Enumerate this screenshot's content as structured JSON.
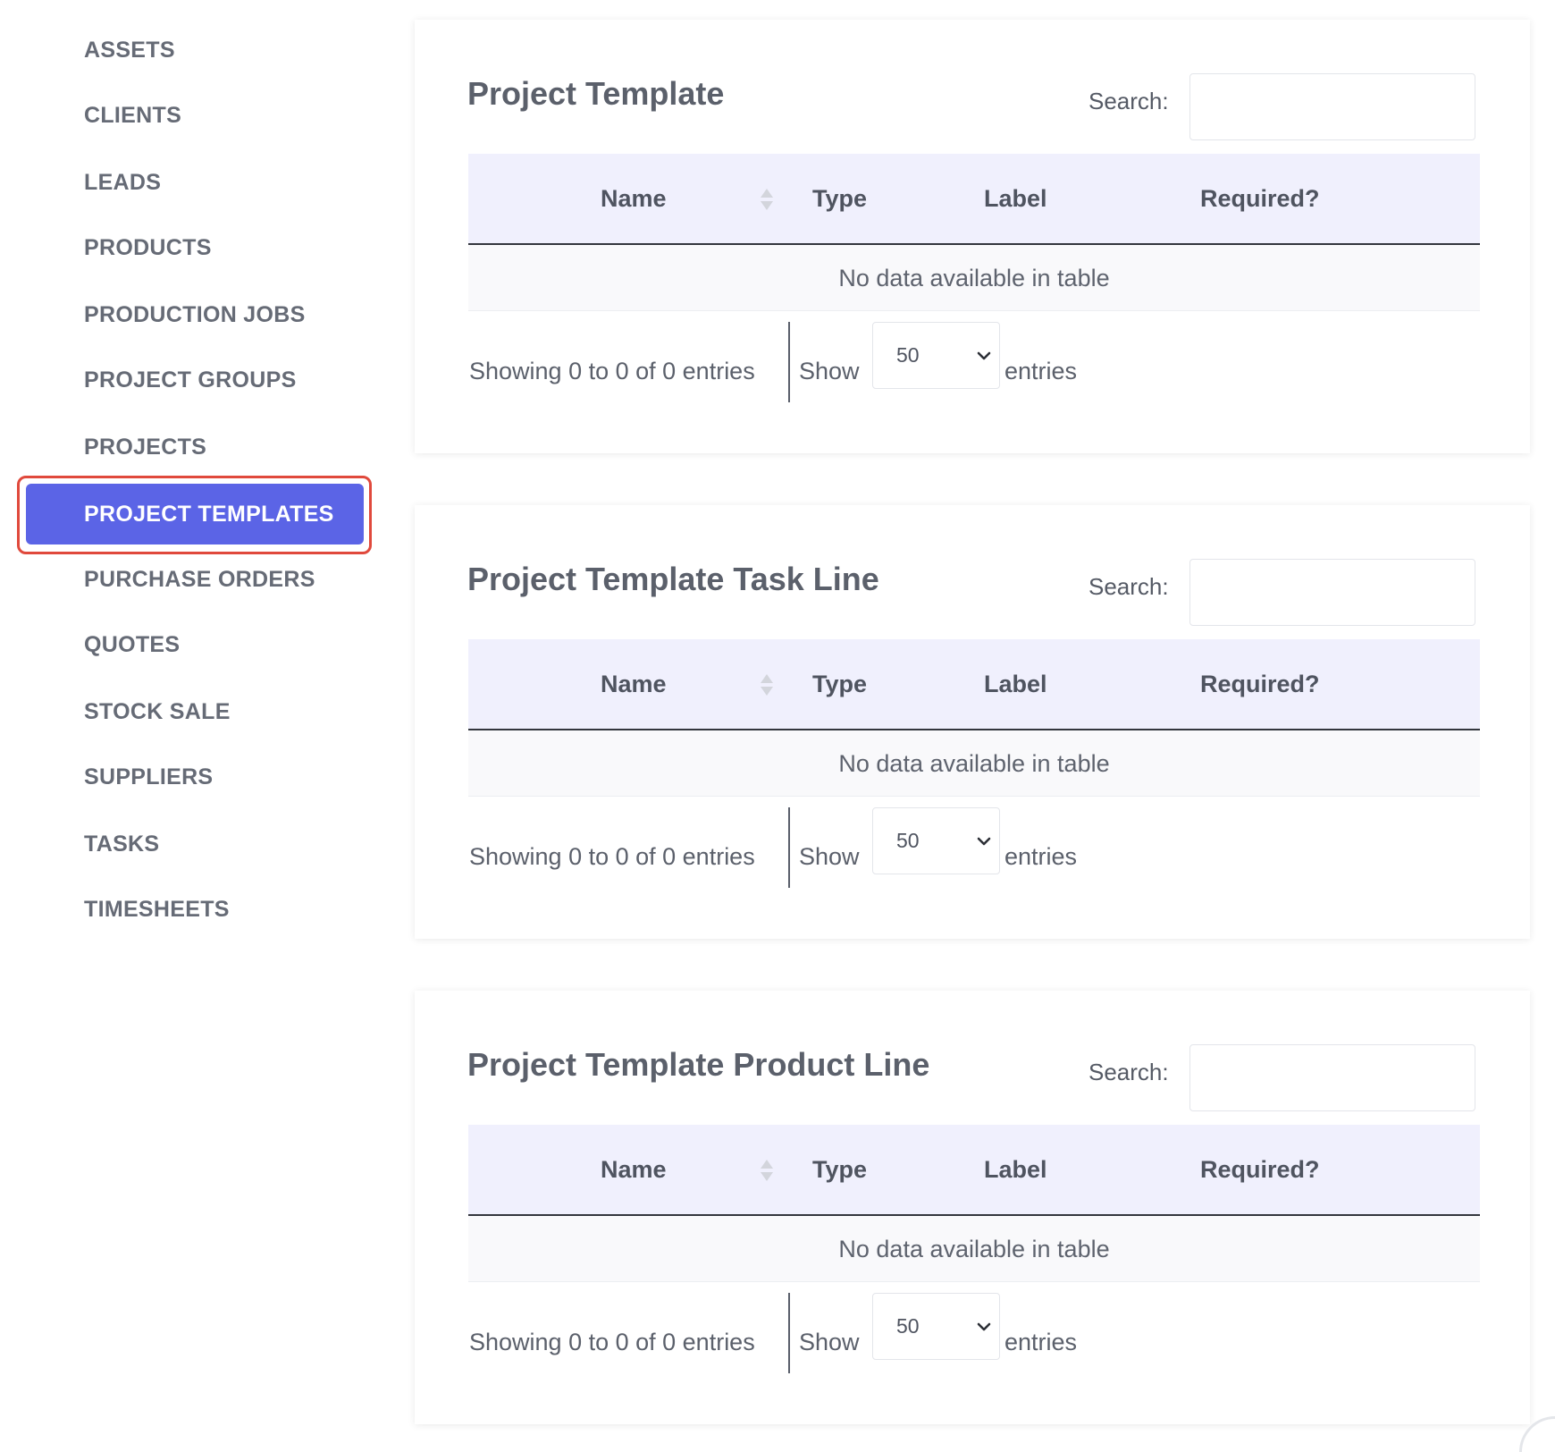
{
  "sidebar": {
    "items": [
      {
        "label": "ASSETS"
      },
      {
        "label": "CLIENTS"
      },
      {
        "label": "LEADS"
      },
      {
        "label": "PRODUCTS"
      },
      {
        "label": "PRODUCTION JOBS"
      },
      {
        "label": "PROJECT GROUPS"
      },
      {
        "label": "PROJECTS"
      },
      {
        "label": "PROJECT TEMPLATES",
        "active": true
      },
      {
        "label": "PURCHASE ORDERS"
      },
      {
        "label": "QUOTES"
      },
      {
        "label": "STOCK SALE"
      },
      {
        "label": "SUPPLIERS"
      },
      {
        "label": "TASKS"
      },
      {
        "label": "TIMESHEETS"
      }
    ],
    "active_color": "#5b64e6",
    "highlight_outline_color": "#e0493c"
  },
  "panels": [
    {
      "title": "Project Template",
      "search_label": "Search:",
      "search_value": "",
      "columns": [
        "Name",
        "Type",
        "Label",
        "Required?"
      ],
      "sort_icon": "sort-both-icon",
      "empty_message": "No data available in table",
      "info": "Showing 0 to 0 of 0 entries",
      "show_label": "Show",
      "page_length": "50",
      "entries_label": "entries"
    },
    {
      "title": "Project Template Task Line",
      "search_label": "Search:",
      "search_value": "",
      "columns": [
        "Name",
        "Type",
        "Label",
        "Required?"
      ],
      "sort_icon": "sort-both-icon",
      "empty_message": "No data available in table",
      "info": "Showing 0 to 0 of 0 entries",
      "show_label": "Show",
      "page_length": "50",
      "entries_label": "entries"
    },
    {
      "title": "Project Template Product Line",
      "search_label": "Search:",
      "search_value": "",
      "columns": [
        "Name",
        "Type",
        "Label",
        "Required?"
      ],
      "sort_icon": "sort-both-icon",
      "empty_message": "No data available in table",
      "info": "Showing 0 to 0 of 0 entries",
      "show_label": "Show",
      "page_length": "50",
      "entries_label": "entries"
    }
  ],
  "colors": {
    "table_header_bg": "#f0f0fd",
    "empty_row_bg": "#f9f9fb"
  }
}
